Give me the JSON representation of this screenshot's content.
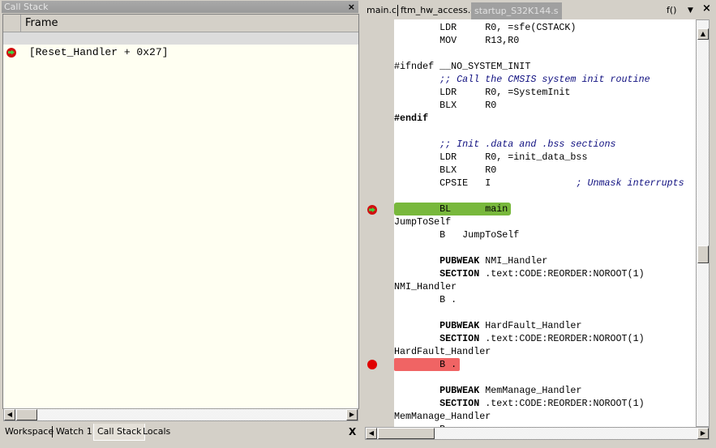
{
  "call_stack": {
    "title": "Call Stack",
    "close": "×",
    "column": "Frame",
    "frames": [
      {
        "label": "[Reset_Handler + 0x27]",
        "icon": "current-pc-arrow-icon"
      }
    ],
    "tabs": [
      "Workspace",
      "Watch 1",
      "Call Stack",
      "Locals"
    ],
    "active_tab": "Call Stack",
    "tabs_close": "X"
  },
  "editor": {
    "tabs": [
      "main.c",
      "ftm_hw_access.c",
      "startup_S32K144.s"
    ],
    "active_tab": "startup_S32K144.s",
    "func_button": "f()",
    "dropdown": "▼",
    "close": "×",
    "lines": [
      {
        "t": "        LDR     R0, =sfe(CSTACK)"
      },
      {
        "t": "        MOV     R13,R0"
      },
      {
        "t": ""
      },
      {
        "t": "#ifndef __NO_SYSTEM_INIT"
      },
      {
        "t": "        ",
        "c": ";; Call the CMSIS system init routine"
      },
      {
        "t": "        LDR     R0, =SystemInit"
      },
      {
        "t": "        BLX     R0"
      },
      {
        "t": "",
        "k": "#endif"
      },
      {
        "t": ""
      },
      {
        "t": "        ",
        "c": ";; Init .data and .bss sections"
      },
      {
        "t": "        LDR     R0, =init_data_bss"
      },
      {
        "t": "        BLX     R0"
      },
      {
        "t": "        CPSIE   I               ",
        "c": "; Unmask interrupts"
      },
      {
        "t": ""
      },
      {
        "t": "        BL      main",
        "hl": "green",
        "marker": "pc"
      },
      {
        "t": "JumpToSelf"
      },
      {
        "t": "        B   JumpToSelf"
      },
      {
        "t": ""
      },
      {
        "t": "        ",
        "k": "PUBWEAK",
        "r": " NMI_Handler"
      },
      {
        "t": "        ",
        "k": "SECTION",
        "r": " .text:CODE:REORDER:NOROOT(1)"
      },
      {
        "t": "NMI_Handler"
      },
      {
        "t": "        B ."
      },
      {
        "t": ""
      },
      {
        "t": "        ",
        "k": "PUBWEAK",
        "r": " HardFault_Handler"
      },
      {
        "t": "        ",
        "k": "SECTION",
        "r": " .text:CODE:REORDER:NOROOT(1)"
      },
      {
        "t": "HardFault_Handler"
      },
      {
        "t": "        B .",
        "hl": "red",
        "marker": "breakpoint"
      },
      {
        "t": ""
      },
      {
        "t": "        ",
        "k": "PUBWEAK",
        "r": " MemManage_Handler"
      },
      {
        "t": "        ",
        "k": "SECTION",
        "r": " .text:CODE:REORDER:NOROOT(1)"
      },
      {
        "t": "MemManage_Handler"
      },
      {
        "t": "        B ."
      }
    ]
  },
  "colors": {
    "pc_highlight": "#78b83c",
    "breakpoint_highlight": "#f06464",
    "breakpoint": "#e00000"
  }
}
